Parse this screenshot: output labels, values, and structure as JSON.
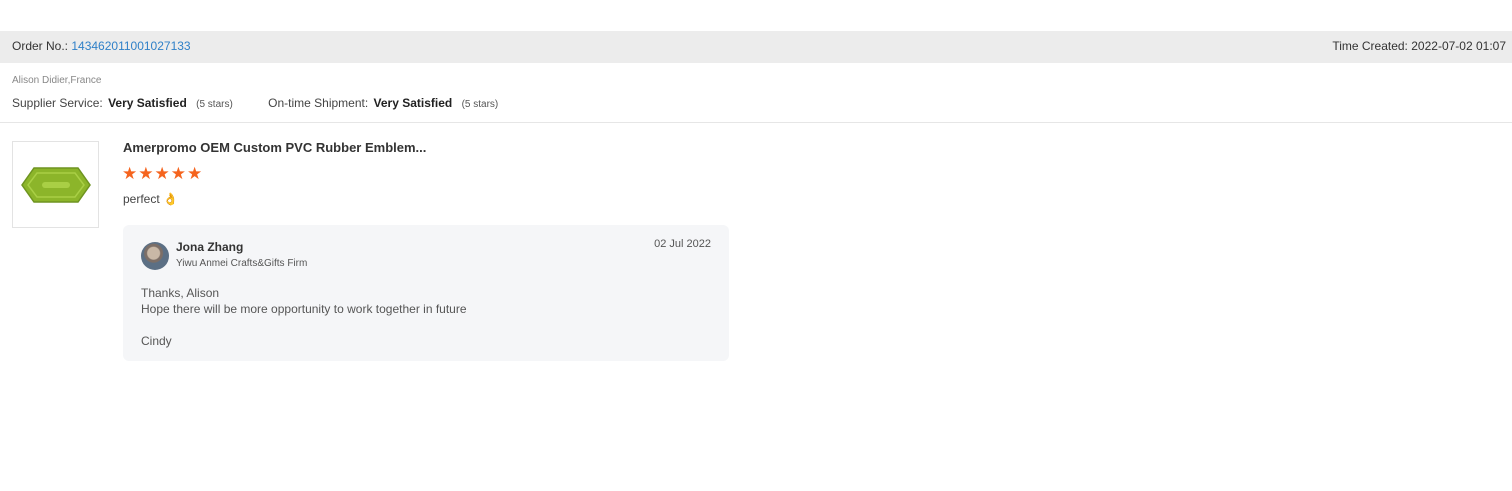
{
  "order": {
    "label": "Order No.:",
    "number": "143462011001027133",
    "time_label": "Time Created:",
    "time_value": "2022-07-02 01:07"
  },
  "buyer": {
    "name_location": "Alison Didier,France"
  },
  "ratings": [
    {
      "label": "Supplier Service:",
      "value": "Very Satisfied",
      "note": "(5 stars)"
    },
    {
      "label": "On-time Shipment:",
      "value": "Very Satisfied",
      "note": "(5 stars)"
    }
  ],
  "product": {
    "title": "Amerpromo OEM Custom PVC Rubber Emblem...",
    "thumbnail_icon": "green-rubber-emblem",
    "stars": "★★★★★",
    "rating": 5,
    "review_text": "perfect",
    "review_emoji": "👌"
  },
  "reply": {
    "name": "Jona Zhang",
    "company": "Yiwu Anmei Crafts&Gifts Firm",
    "date": "02 Jul 2022",
    "line1": "Thanks, Alison",
    "line2": "Hope there will be more opportunity to work together in future",
    "signature": "Cindy"
  },
  "colors": {
    "link": "#2f80c8",
    "star": "#f5641e",
    "emblem": "#8cb52a"
  }
}
